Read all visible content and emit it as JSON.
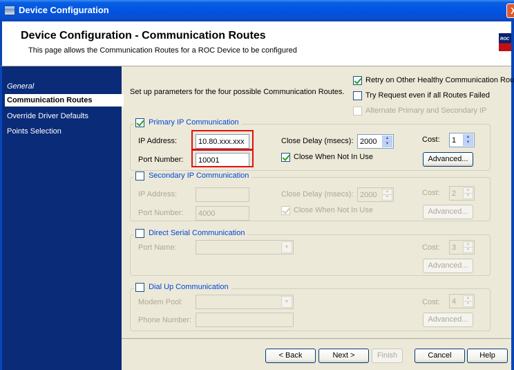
{
  "window": {
    "title": "Device Configuration",
    "close_label": "X"
  },
  "header": {
    "title": "Device Configuration - Communication Routes",
    "description": "This page allows the Communication Routes for a ROC Device to be configured",
    "logo_text": "ROC"
  },
  "nav": {
    "heading": "General",
    "items": [
      "Communication Routes",
      "Override Driver Defaults",
      "Points Selection"
    ],
    "active": "Communication Routes"
  },
  "options": {
    "intro": "Set up parameters for the four possible Communication Routes.",
    "retry_label": "Retry on Other Healthy Communication Routes",
    "try_request_label": "Try Request even if all Routes Failed",
    "alternate_label": "Alternate Primary and Secondary IP"
  },
  "primary": {
    "title": "Primary IP Communication",
    "ip_label": "IP Address:",
    "ip_value": "10.80.xxx.xxx",
    "port_label": "Port Number:",
    "port_value": "10001",
    "close_delay_label": "Close Delay (msecs):",
    "close_delay_value": "2000",
    "cost_label": "Cost:",
    "cost_value": "1",
    "close_when_label": "Close When Not In Use",
    "advanced_label": "Advanced..."
  },
  "secondary": {
    "title": "Secondary IP Communication",
    "ip_label": "IP Address:",
    "ip_value": "",
    "port_label": "Port Number:",
    "port_value": "4000",
    "close_delay_label": "Close Delay (msecs):",
    "close_delay_value": "2000",
    "cost_label": "Cost:",
    "cost_value": "2",
    "close_when_label": "Close When Not In Use",
    "advanced_label": "Advanced..."
  },
  "serial": {
    "title": "Direct Serial Communication",
    "port_name_label": "Port Name:",
    "cost_label": "Cost:",
    "cost_value": "3",
    "advanced_label": "Advanced..."
  },
  "dialup": {
    "title": "Dial Up Communication",
    "modem_label": "Modem Pool:",
    "phone_label": "Phone Number:",
    "cost_label": "Cost:",
    "cost_value": "4",
    "advanced_label": "Advanced..."
  },
  "buttons": {
    "back": "< Back",
    "next": "Next >",
    "finish": "Finish",
    "cancel": "Cancel",
    "help": "Help"
  },
  "colors": {
    "title_bar": "#0054e3",
    "nav_bg": "#0a2b78",
    "highlight": "#e01010",
    "group_title": "#0046d5"
  }
}
